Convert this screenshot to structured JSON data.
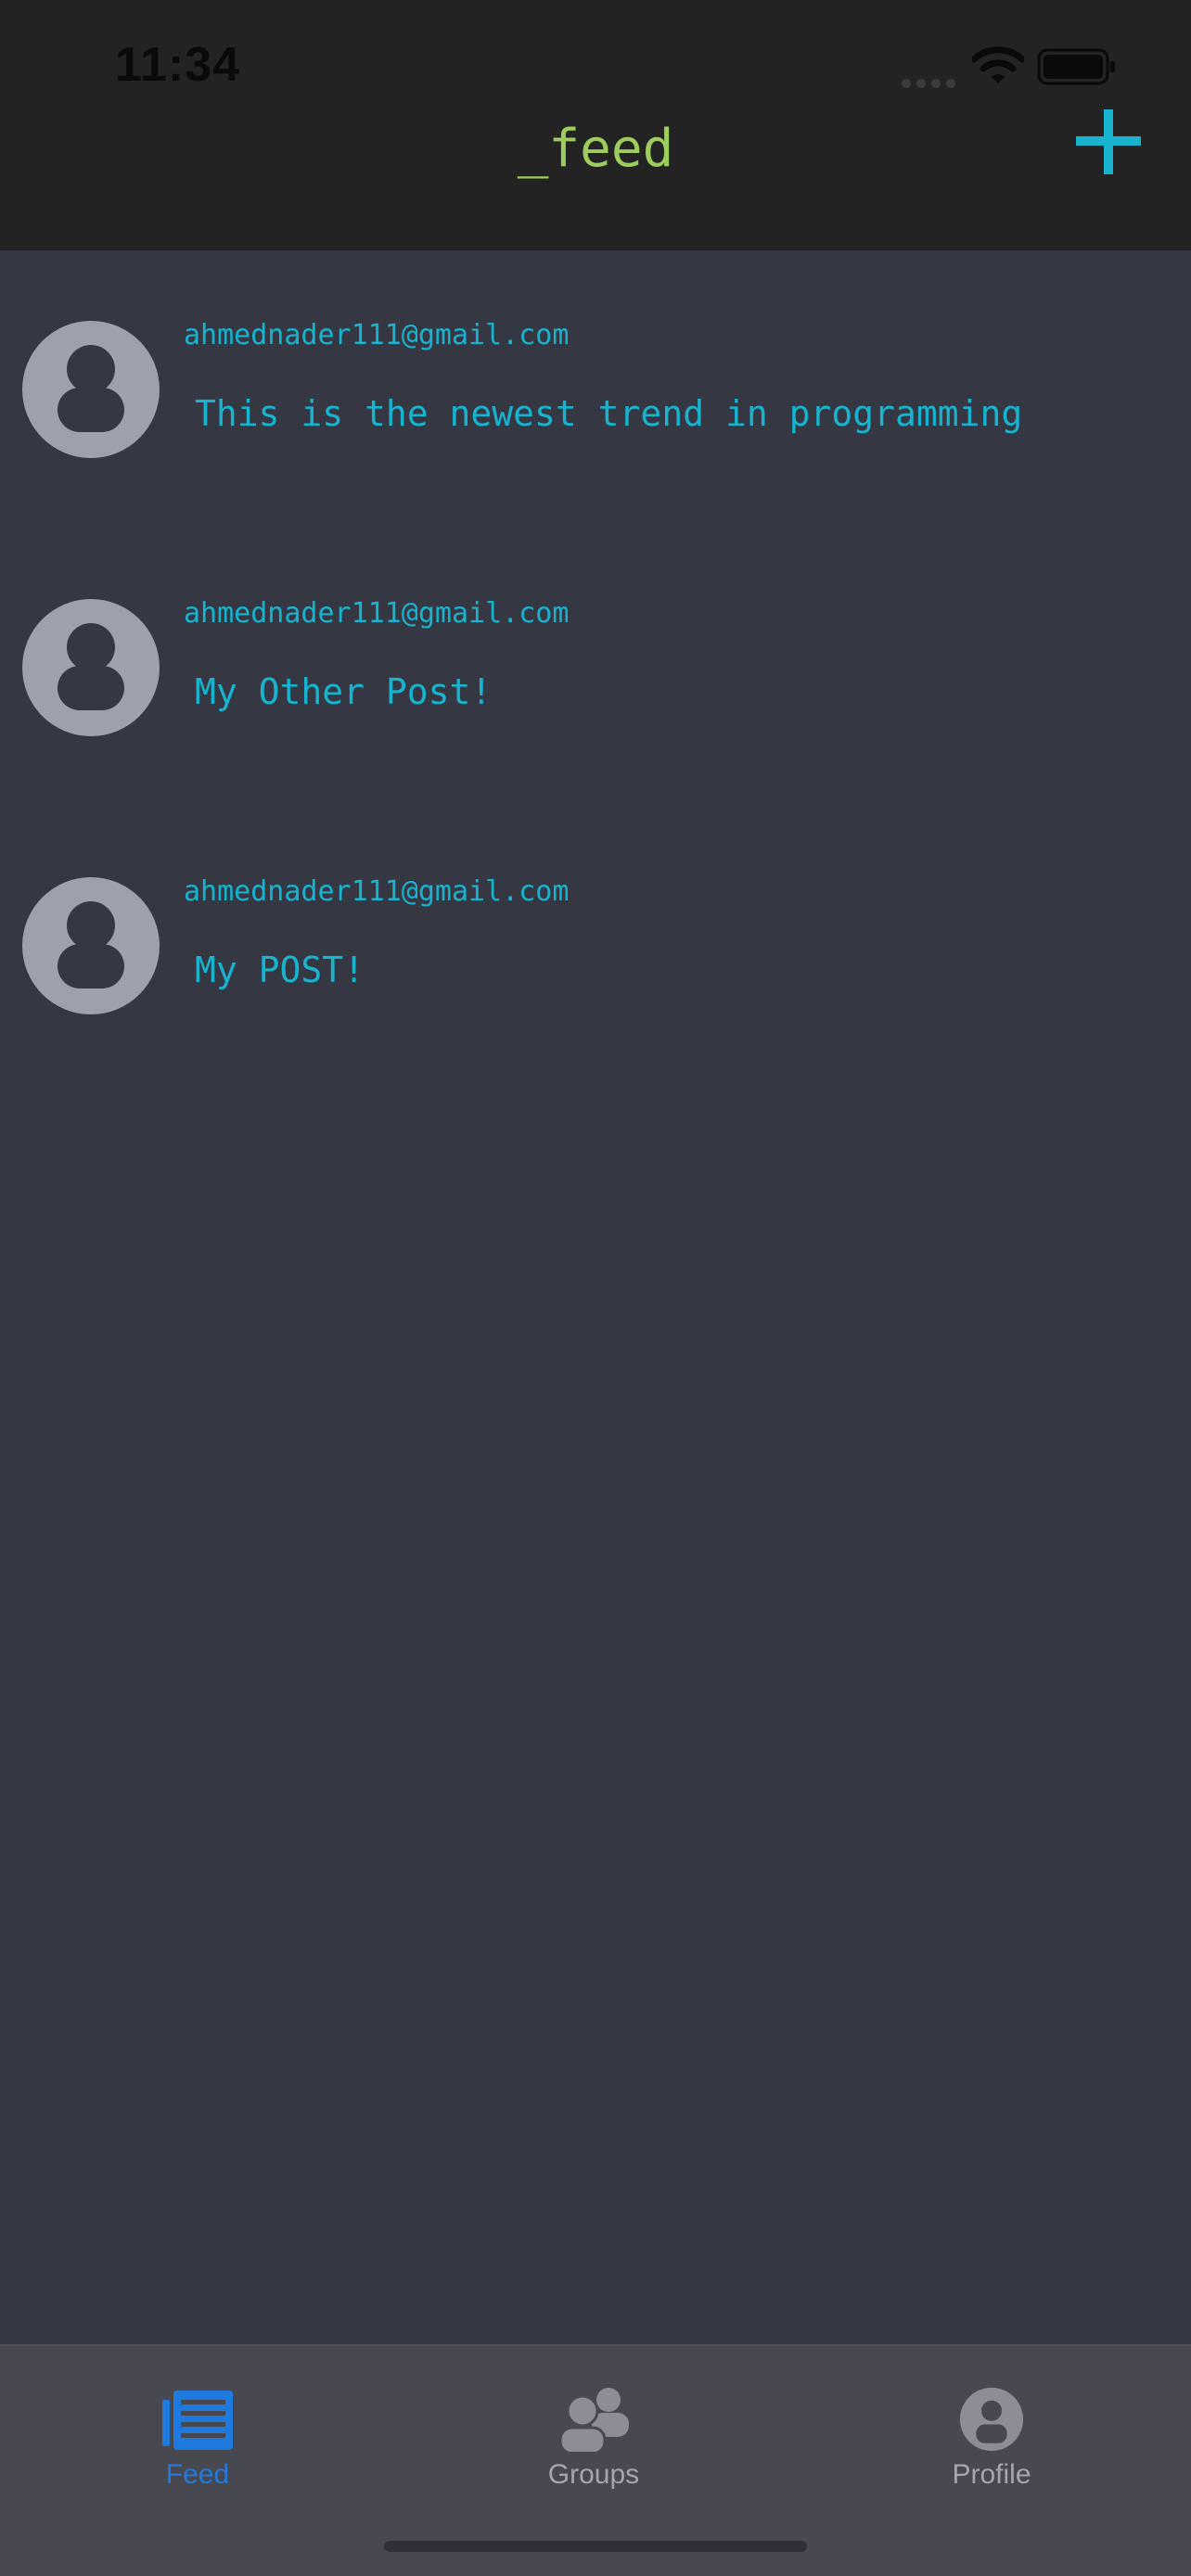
{
  "status_bar": {
    "time": "11:34"
  },
  "header": {
    "title": "_feed"
  },
  "posts": [
    {
      "author": "ahmednader111@gmail.com",
      "text": "This is the newest trend in programming"
    },
    {
      "author": "ahmednader111@gmail.com",
      "text": "My Other Post!"
    },
    {
      "author": "ahmednader111@gmail.com",
      "text": "My POST!"
    }
  ],
  "tabs": [
    {
      "label": "Feed",
      "icon": "newspaper-icon",
      "active": true
    },
    {
      "label": "Groups",
      "icon": "groups-icon",
      "active": false
    },
    {
      "label": "Profile",
      "icon": "profile-icon",
      "active": false
    }
  ],
  "colors": {
    "accent": "#17b3cf",
    "title": "#9fcc5e",
    "active_tab": "#1f7ae0",
    "background": "#353843",
    "header": "#232323"
  }
}
